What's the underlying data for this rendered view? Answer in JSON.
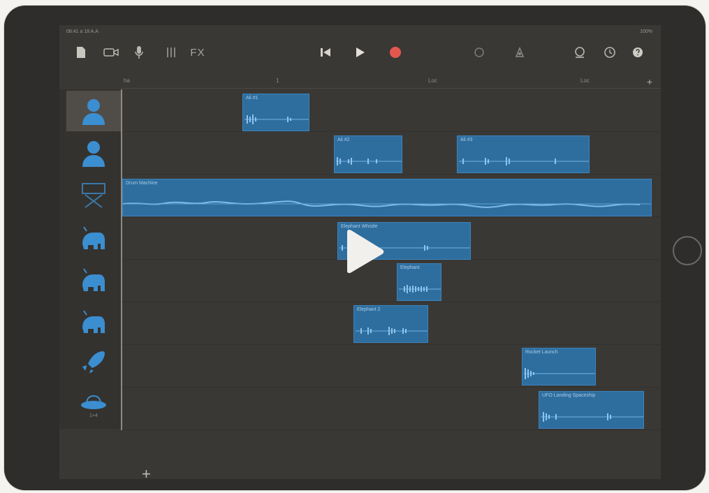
{
  "status_bar": {
    "time": "08:41  a 18 A.A",
    "battery": "100%"
  },
  "toolbar": {
    "fx_label": "FX",
    "icons": [
      "document-icon",
      "camera-icon",
      "microphone-icon",
      "mixer-icon",
      "rewind-icon",
      "play-icon",
      "record-icon",
      "metronome-icon",
      "loop-icon",
      "tempo-icon",
      "settings-icon",
      "help-icon"
    ]
  },
  "ruler": {
    "bars": [
      "ha",
      "1",
      "Loc",
      "Loc"
    ],
    "add_label": "+"
  },
  "tracks": {
    "items": [
      "voice-icon",
      "voice-icon",
      "drum-machine-icon",
      "elephant-icon",
      "elephant-icon",
      "elephant-icon",
      "rocket-icon",
      "ufo-icon"
    ],
    "ufo_label": "1+4",
    "add_label": "+"
  },
  "regions": [
    {
      "label": "Ali #1"
    },
    {
      "label": "Ali #2"
    },
    {
      "label": "Ali #3"
    },
    {
      "label": "Drum Machine"
    },
    {
      "label": "Elephant Whistle"
    },
    {
      "label": "Elephant"
    },
    {
      "label": "Elephant 2"
    },
    {
      "label": "Rocket Launch"
    },
    {
      "label": "UFO Landing Spaceship"
    }
  ],
  "colors": {
    "accent": "#3b84bd",
    "record": "#e4574f",
    "region_fill": "#2e6e9f"
  }
}
